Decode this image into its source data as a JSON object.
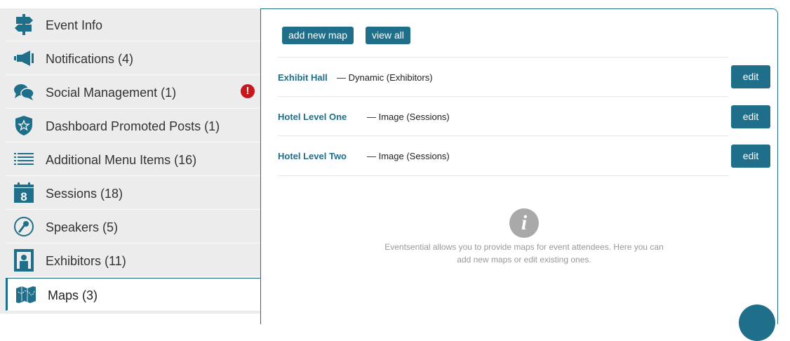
{
  "sidebar": {
    "items": [
      {
        "label": "Event Info",
        "icon": "signpost-icon"
      },
      {
        "label": "Notifications (4)",
        "icon": "megaphone-icon"
      },
      {
        "label": "Social Management (1)",
        "icon": "chat-bubbles-icon",
        "alert": "!"
      },
      {
        "label": "Dashboard Promoted Posts (1)",
        "icon": "shield-star-icon"
      },
      {
        "label": "Additional Menu Items (16)",
        "icon": "list-icon"
      },
      {
        "label": "Sessions (18)",
        "icon": "calendar-icon",
        "icon_text": "8"
      },
      {
        "label": "Speakers (5)",
        "icon": "microphone-icon"
      },
      {
        "label": "Exhibitors (11)",
        "icon": "booth-icon"
      },
      {
        "label": "Maps (3)",
        "icon": "map-icon",
        "active": true
      }
    ]
  },
  "main": {
    "add_button": "add new map",
    "view_all_button": "view all",
    "maps": [
      {
        "name": "Exhibit Hall",
        "type": "— Dynamic (Exhibitors)",
        "edit": "edit"
      },
      {
        "name": "Hotel Level One",
        "type": "— Image (Sessions)",
        "edit": "edit"
      },
      {
        "name": "Hotel Level Two",
        "type": "— Image (Sessions)",
        "edit": "edit"
      }
    ],
    "info_icon_glyph": "i",
    "info_line1": "Eventsential allows you to provide maps for event attendees. Here you can",
    "info_line2": "add new maps or edit existing ones."
  },
  "colors": {
    "accent": "#1f6f8b",
    "alert": "#c7161d",
    "sidebar_bg": "#ececec"
  }
}
